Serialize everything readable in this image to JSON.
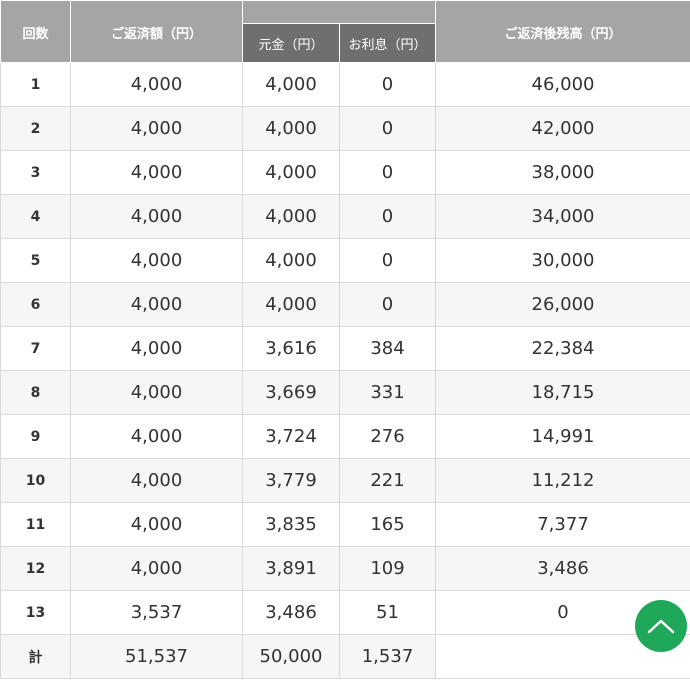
{
  "header": {
    "no": "回数",
    "payment": "ご返済額（円）",
    "principal": "元金（円）",
    "interest": "お利息（円）",
    "balance": "ご返済後残高（円）"
  },
  "rows": [
    {
      "no": "1",
      "payment": "4,000",
      "principal": "4,000",
      "interest": "0",
      "balance": "46,000"
    },
    {
      "no": "2",
      "payment": "4,000",
      "principal": "4,000",
      "interest": "0",
      "balance": "42,000"
    },
    {
      "no": "3",
      "payment": "4,000",
      "principal": "4,000",
      "interest": "0",
      "balance": "38,000"
    },
    {
      "no": "4",
      "payment": "4,000",
      "principal": "4,000",
      "interest": "0",
      "balance": "34,000"
    },
    {
      "no": "5",
      "payment": "4,000",
      "principal": "4,000",
      "interest": "0",
      "balance": "30,000"
    },
    {
      "no": "6",
      "payment": "4,000",
      "principal": "4,000",
      "interest": "0",
      "balance": "26,000"
    },
    {
      "no": "7",
      "payment": "4,000",
      "principal": "3,616",
      "interest": "384",
      "balance": "22,384"
    },
    {
      "no": "8",
      "payment": "4,000",
      "principal": "3,669",
      "interest": "331",
      "balance": "18,715"
    },
    {
      "no": "9",
      "payment": "4,000",
      "principal": "3,724",
      "interest": "276",
      "balance": "14,991"
    },
    {
      "no": "10",
      "payment": "4,000",
      "principal": "3,779",
      "interest": "221",
      "balance": "11,212"
    },
    {
      "no": "11",
      "payment": "4,000",
      "principal": "3,835",
      "interest": "165",
      "balance": "7,377"
    },
    {
      "no": "12",
      "payment": "4,000",
      "principal": "3,891",
      "interest": "109",
      "balance": "3,486"
    },
    {
      "no": "13",
      "payment": "3,537",
      "principal": "3,486",
      "interest": "51",
      "balance": "0"
    }
  ],
  "total": {
    "no": "計",
    "payment": "51,537",
    "principal": "50,000",
    "interest": "1,537",
    "balance": ""
  },
  "scroll_top_icon": "chevron-up-icon",
  "colors": {
    "header_bg": "#a5a5a5",
    "subheader_bg": "#6f6f6f",
    "alt_row_bg": "#f6f6f6",
    "scroll_top_bg": "#1fa85a"
  }
}
